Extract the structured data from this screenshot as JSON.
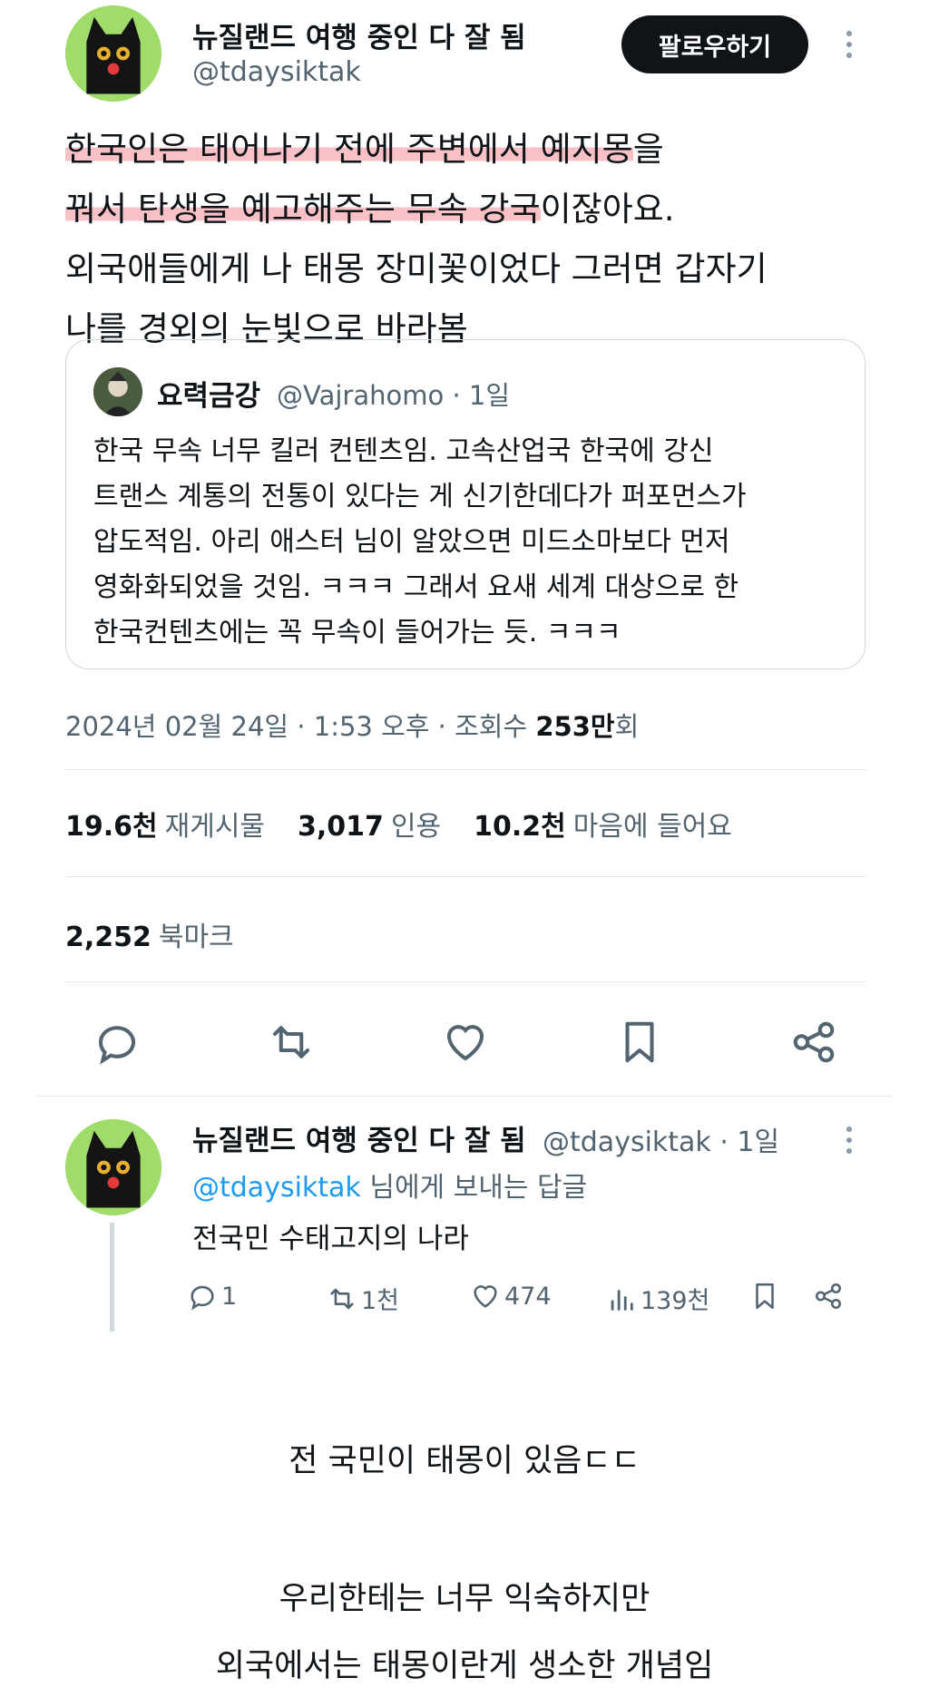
{
  "post": {
    "author_name": "뉴질랜드 여행 중인 다 잘 됨",
    "author_handle": "@tdaysiktak",
    "follow_label": "팔로우하기",
    "text_lines": [
      {
        "hl": "한국인은 태어나기 전에 주변에서 예지몽",
        "rest": "을"
      },
      {
        "hl": "꿔서 탄생을 예고해주는 무속 강국",
        "rest": "이잖아요."
      },
      {
        "hl": "",
        "rest": "외국애들에게 나 태몽 장미꽃이었다 그러면 갑자기"
      },
      {
        "hl": "",
        "rest": "나를 경외의 눈빛으로 바라봄"
      }
    ],
    "highlight_color": "#f48e98"
  },
  "quote": {
    "name": "요력금강",
    "handle_time": "@Vajrahomo · 1일",
    "lines": [
      "한국 무속 너무 킬러 컨텐츠임. 고속산업국 한국에 강신",
      "트랜스 계통의 전통이 있다는 게 신기한데다가 퍼포먼스가",
      "압도적임. 아리 애스터 님이 알았으면 미드소마보다 먼저",
      "영화화되었을 것임. ㅋㅋㅋ 그래서 요새 세계 대상으로 한",
      "한국컨텐츠에는 꼭 무속이 들어가는 듯. ㅋㅋㅋ"
    ]
  },
  "meta": {
    "datetime": "2024년 02월 24일 · 1:53 오후 · 조회수 ",
    "views_num": "253만",
    "views_unit": "회"
  },
  "stats": {
    "retweets_num": "19.6천",
    "retweets_label": "재게시물",
    "quotes_num": "3,017",
    "quotes_label": "인용",
    "likes_num": "10.2천",
    "likes_label": "마음에 들어요",
    "bookmarks_num": "2,252",
    "bookmarks_label": "북마크"
  },
  "reply": {
    "author_name": "뉴질랜드 여행 중인 다 잘 됨",
    "handle_time": "@tdaysiktak · 1일",
    "reply_to_mention": "@tdaysiktak",
    "reply_to_suffix": " 님에게 보내는 답글",
    "text": "전국민 수태고지의 나라",
    "replies": "1",
    "retweets": "1천",
    "likes": "474",
    "views": "139천"
  },
  "caption": {
    "line1": "전 국민이 태몽이 있음ㄷㄷ",
    "line2": "우리한테는 너무 익숙하지만",
    "line3": "외국에서는 태몽이란게 생소한 개념임"
  },
  "colors": {
    "accent": "#1d9bf0",
    "muted": "#536471",
    "avatar_bg": "#9fdc6a"
  }
}
